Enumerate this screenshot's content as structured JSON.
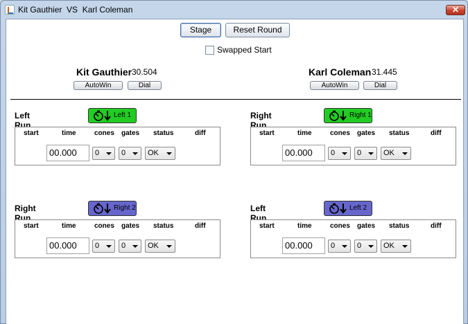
{
  "window": {
    "title": "Kit Gauthier  VS  Karl Coleman",
    "close_glyph": "✕"
  },
  "toolbar": {
    "stage_label": "Stage",
    "reset_label": "Reset Round",
    "swapped_start_label": "Swapped Start",
    "swapped_start_checked": false
  },
  "drivers": [
    {
      "name": "Kit Gauthier",
      "time": "30.504",
      "autowin_label": "AutoWin",
      "dial_label": "Dial"
    },
    {
      "name": "Karl Coleman",
      "time": "31.445",
      "autowin_label": "AutoWin",
      "dial_label": "Dial"
    }
  ],
  "columns": [
    "start",
    "time",
    "cones",
    "gates",
    "status",
    "diff"
  ],
  "runs": [
    {
      "title": "Left Run",
      "lane_label": "Left 1",
      "lane_color": "#22cc22",
      "time": "00.000",
      "cones": "0",
      "gates": "0",
      "status": "OK"
    },
    {
      "title": "Right Run",
      "lane_label": "Right 1",
      "lane_color": "#22cc22",
      "time": "00.000",
      "cones": "0",
      "gates": "0",
      "status": "OK"
    },
    {
      "title": "Right Run",
      "lane_label": "Right 2",
      "lane_color": "#6666cc",
      "time": "00.000",
      "cones": "0",
      "gates": "0",
      "status": "OK"
    },
    {
      "title": "Left Run",
      "lane_label": "Left 2",
      "lane_color": "#6666cc",
      "time": "00.000",
      "cones": "0",
      "gates": "0",
      "status": "OK"
    }
  ]
}
